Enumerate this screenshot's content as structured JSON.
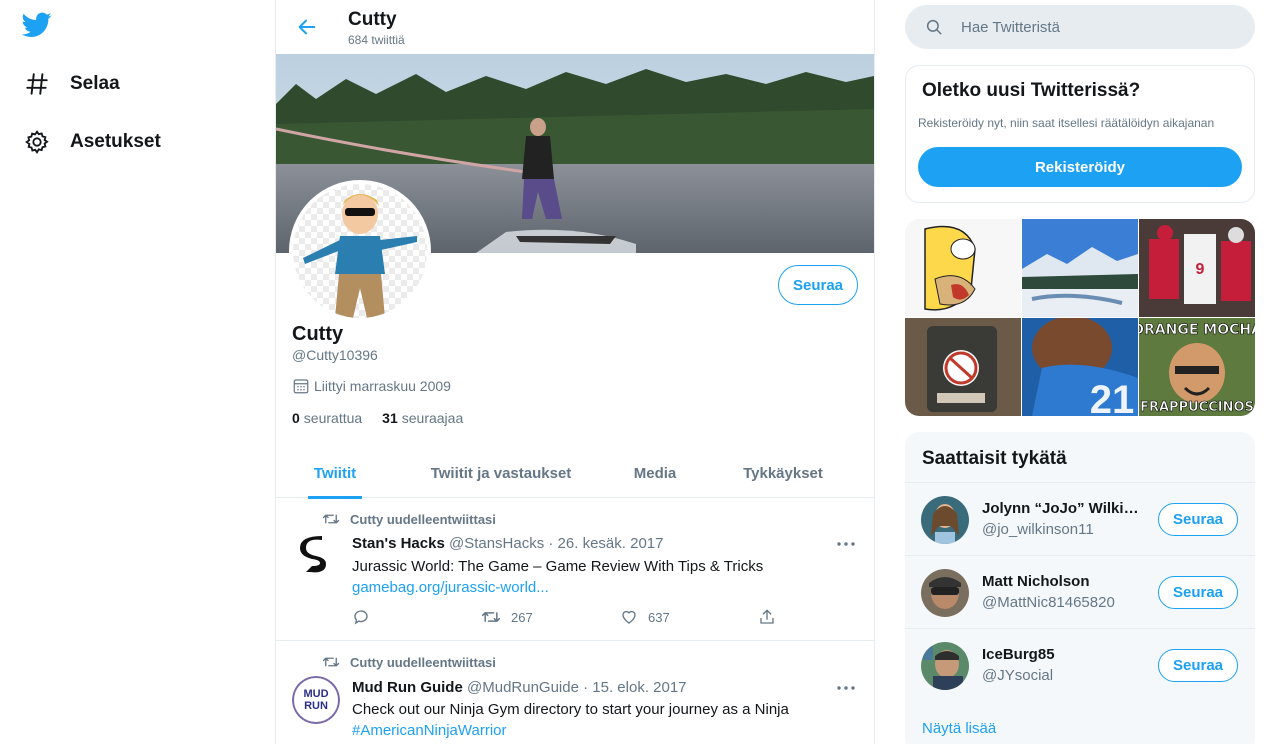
{
  "nav": {
    "logo_icon": "twitter-bird-icon",
    "items": [
      {
        "label": "Selaa",
        "icon": "hashtag-icon"
      },
      {
        "label": "Asetukset",
        "icon": "gear-icon"
      }
    ]
  },
  "header": {
    "title": "Cutty",
    "tweet_count": "684 twiittiä"
  },
  "profile": {
    "name": "Cutty",
    "handle": "@Cutty10396",
    "joined": "Liittyi marraskuu 2009",
    "following_count": "0",
    "following_label": "seurattua",
    "followers_count": "31",
    "followers_label": "seuraajaa",
    "follow_label": "Seuraa"
  },
  "tabs": [
    {
      "label": "Twiitit",
      "active": true
    },
    {
      "label": "Twiitit ja vastaukset",
      "active": false
    },
    {
      "label": "Media",
      "active": false
    },
    {
      "label": "Tykkäykset",
      "active": false
    }
  ],
  "tweets": [
    {
      "retweet_note": "Cutty uudelleentwiittasi",
      "name": "Stan's Hacks",
      "meta": "@StansHacks · 26. kesäk. 2017",
      "text": "Jurassic World: The Game – Game Review With Tips & Tricks",
      "link": "gamebag.org/jurassic-world...",
      "retweets": "267",
      "likes": "637"
    },
    {
      "retweet_note": "Cutty uudelleentwiittasi",
      "name": "Mud Run Guide",
      "meta": "@MudRunGuide · 15. elok. 2017",
      "text": "Check out our Ninja Gym directory to start your journey as a Ninja",
      "link": "#AmericanNinjaWarrior"
    }
  ],
  "search": {
    "placeholder": "Hae Twitteristä"
  },
  "new_user": {
    "title": "Oletko uusi Twitterissä?",
    "subtitle": "Rekisteröidy nyt, niin saat itsellesi räätälöidyn aikajanan",
    "button": "Rekisteröidy"
  },
  "media_grid": {
    "labels": [
      "ORANGE MOCHA",
      "FRAPPUCCINOS"
    ]
  },
  "who_to_follow": {
    "title": "Saattaisit tykätä",
    "users": [
      {
        "name": "Jolynn “JoJo” Wilkinson",
        "handle": "@jo_wilkinson11",
        "button": "Seuraa"
      },
      {
        "name": "Matt Nicholson",
        "handle": "@MattNic81465820",
        "button": "Seuraa"
      },
      {
        "name": "IceBurg85",
        "handle": "@JYsocial",
        "button": "Seuraa"
      }
    ],
    "show_more": "Näytä lisää"
  },
  "colors": {
    "accent": "#1da1f2",
    "text": "#14171a",
    "muted": "#657786",
    "border": "#e6ecf0"
  }
}
